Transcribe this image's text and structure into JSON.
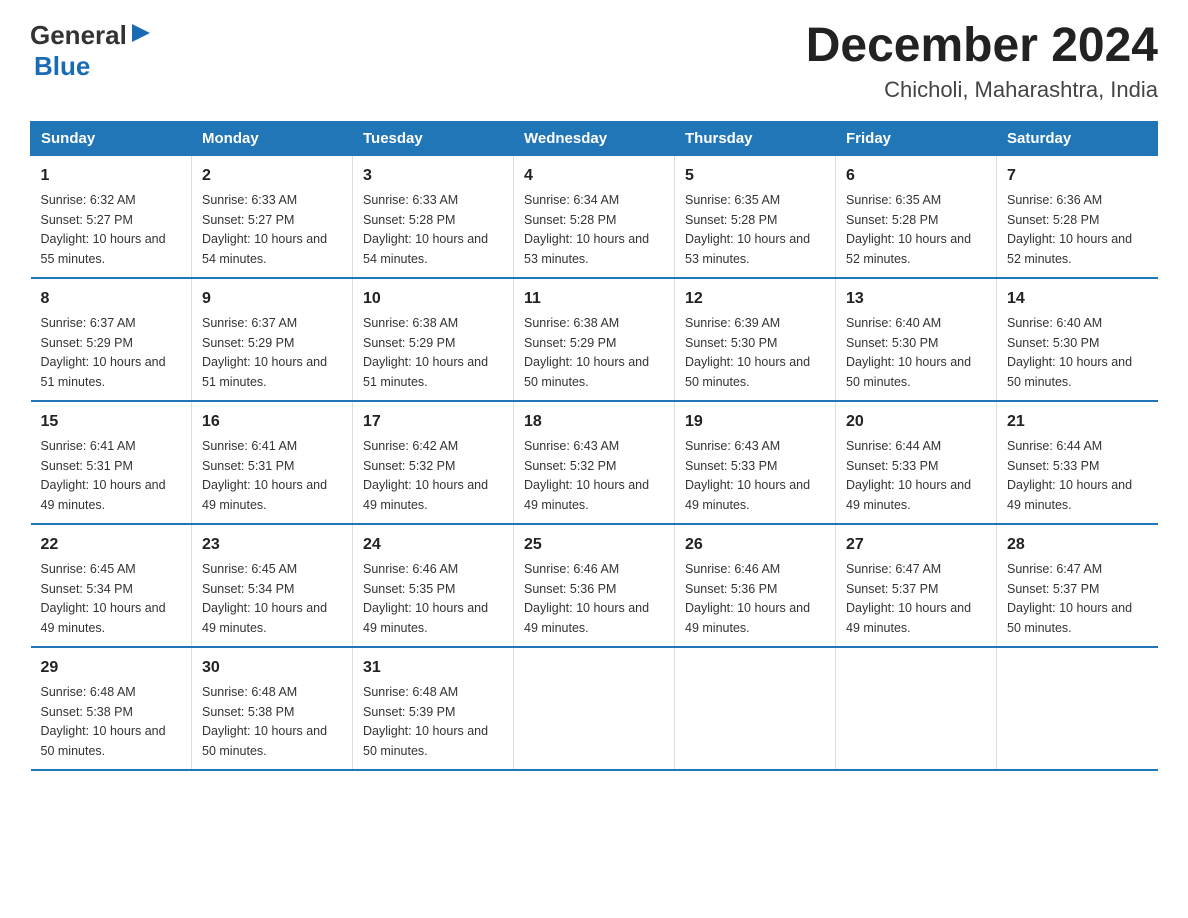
{
  "logo": {
    "general": "General",
    "arrow": "▶",
    "blue": "Blue"
  },
  "title": "December 2024",
  "subtitle": "Chicholi, Maharashtra, India",
  "days_of_week": [
    "Sunday",
    "Monday",
    "Tuesday",
    "Wednesday",
    "Thursday",
    "Friday",
    "Saturday"
  ],
  "weeks": [
    [
      {
        "day": 1,
        "sunrise": "6:32 AM",
        "sunset": "5:27 PM",
        "daylight": "10 hours and 55 minutes."
      },
      {
        "day": 2,
        "sunrise": "6:33 AM",
        "sunset": "5:27 PM",
        "daylight": "10 hours and 54 minutes."
      },
      {
        "day": 3,
        "sunrise": "6:33 AM",
        "sunset": "5:28 PM",
        "daylight": "10 hours and 54 minutes."
      },
      {
        "day": 4,
        "sunrise": "6:34 AM",
        "sunset": "5:28 PM",
        "daylight": "10 hours and 53 minutes."
      },
      {
        "day": 5,
        "sunrise": "6:35 AM",
        "sunset": "5:28 PM",
        "daylight": "10 hours and 53 minutes."
      },
      {
        "day": 6,
        "sunrise": "6:35 AM",
        "sunset": "5:28 PM",
        "daylight": "10 hours and 52 minutes."
      },
      {
        "day": 7,
        "sunrise": "6:36 AM",
        "sunset": "5:28 PM",
        "daylight": "10 hours and 52 minutes."
      }
    ],
    [
      {
        "day": 8,
        "sunrise": "6:37 AM",
        "sunset": "5:29 PM",
        "daylight": "10 hours and 51 minutes."
      },
      {
        "day": 9,
        "sunrise": "6:37 AM",
        "sunset": "5:29 PM",
        "daylight": "10 hours and 51 minutes."
      },
      {
        "day": 10,
        "sunrise": "6:38 AM",
        "sunset": "5:29 PM",
        "daylight": "10 hours and 51 minutes."
      },
      {
        "day": 11,
        "sunrise": "6:38 AM",
        "sunset": "5:29 PM",
        "daylight": "10 hours and 50 minutes."
      },
      {
        "day": 12,
        "sunrise": "6:39 AM",
        "sunset": "5:30 PM",
        "daylight": "10 hours and 50 minutes."
      },
      {
        "day": 13,
        "sunrise": "6:40 AM",
        "sunset": "5:30 PM",
        "daylight": "10 hours and 50 minutes."
      },
      {
        "day": 14,
        "sunrise": "6:40 AM",
        "sunset": "5:30 PM",
        "daylight": "10 hours and 50 minutes."
      }
    ],
    [
      {
        "day": 15,
        "sunrise": "6:41 AM",
        "sunset": "5:31 PM",
        "daylight": "10 hours and 49 minutes."
      },
      {
        "day": 16,
        "sunrise": "6:41 AM",
        "sunset": "5:31 PM",
        "daylight": "10 hours and 49 minutes."
      },
      {
        "day": 17,
        "sunrise": "6:42 AM",
        "sunset": "5:32 PM",
        "daylight": "10 hours and 49 minutes."
      },
      {
        "day": 18,
        "sunrise": "6:43 AM",
        "sunset": "5:32 PM",
        "daylight": "10 hours and 49 minutes."
      },
      {
        "day": 19,
        "sunrise": "6:43 AM",
        "sunset": "5:33 PM",
        "daylight": "10 hours and 49 minutes."
      },
      {
        "day": 20,
        "sunrise": "6:44 AM",
        "sunset": "5:33 PM",
        "daylight": "10 hours and 49 minutes."
      },
      {
        "day": 21,
        "sunrise": "6:44 AM",
        "sunset": "5:33 PM",
        "daylight": "10 hours and 49 minutes."
      }
    ],
    [
      {
        "day": 22,
        "sunrise": "6:45 AM",
        "sunset": "5:34 PM",
        "daylight": "10 hours and 49 minutes."
      },
      {
        "day": 23,
        "sunrise": "6:45 AM",
        "sunset": "5:34 PM",
        "daylight": "10 hours and 49 minutes."
      },
      {
        "day": 24,
        "sunrise": "6:46 AM",
        "sunset": "5:35 PM",
        "daylight": "10 hours and 49 minutes."
      },
      {
        "day": 25,
        "sunrise": "6:46 AM",
        "sunset": "5:36 PM",
        "daylight": "10 hours and 49 minutes."
      },
      {
        "day": 26,
        "sunrise": "6:46 AM",
        "sunset": "5:36 PM",
        "daylight": "10 hours and 49 minutes."
      },
      {
        "day": 27,
        "sunrise": "6:47 AM",
        "sunset": "5:37 PM",
        "daylight": "10 hours and 49 minutes."
      },
      {
        "day": 28,
        "sunrise": "6:47 AM",
        "sunset": "5:37 PM",
        "daylight": "10 hours and 50 minutes."
      }
    ],
    [
      {
        "day": 29,
        "sunrise": "6:48 AM",
        "sunset": "5:38 PM",
        "daylight": "10 hours and 50 minutes."
      },
      {
        "day": 30,
        "sunrise": "6:48 AM",
        "sunset": "5:38 PM",
        "daylight": "10 hours and 50 minutes."
      },
      {
        "day": 31,
        "sunrise": "6:48 AM",
        "sunset": "5:39 PM",
        "daylight": "10 hours and 50 minutes."
      },
      null,
      null,
      null,
      null
    ]
  ]
}
